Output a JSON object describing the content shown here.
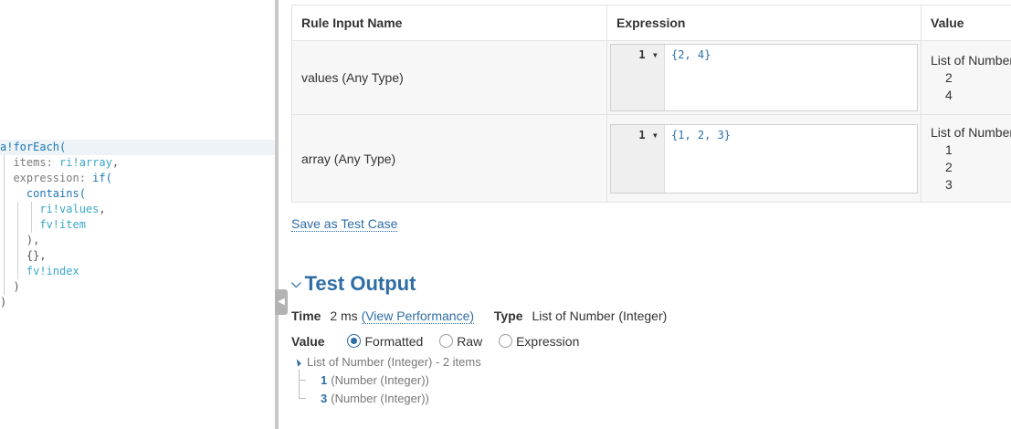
{
  "code_editor": {
    "lines": [
      {
        "parts": [
          {
            "t": "a!forEach(",
            "c": "fn"
          }
        ]
      },
      {
        "parts": [
          {
            "t": "  items: ",
            "c": "key"
          },
          {
            "t": "ri!array",
            "c": "ref"
          },
          {
            "t": ",",
            "c": "p"
          }
        ]
      },
      {
        "parts": [
          {
            "t": "  expression: ",
            "c": "key"
          },
          {
            "t": "if(",
            "c": "fn"
          }
        ]
      },
      {
        "parts": [
          {
            "t": "    contains(",
            "c": "fn"
          }
        ]
      },
      {
        "parts": [
          {
            "t": "      ri!values",
            "c": "ref"
          },
          {
            "t": ",",
            "c": "p"
          }
        ]
      },
      {
        "parts": [
          {
            "t": "      fv!item",
            "c": "ref"
          }
        ]
      },
      {
        "parts": [
          {
            "t": "    ),",
            "c": "p"
          }
        ]
      },
      {
        "parts": [
          {
            "t": "    {},",
            "c": "p"
          }
        ]
      },
      {
        "parts": [
          {
            "t": "    fv!index",
            "c": "ref"
          }
        ]
      },
      {
        "parts": [
          {
            "t": "  )",
            "c": "p"
          }
        ]
      },
      {
        "parts": [
          {
            "t": ")",
            "c": "p"
          }
        ]
      }
    ]
  },
  "rule_inputs": {
    "headers": [
      "Rule Input Name",
      "Expression",
      "Value"
    ],
    "rows": [
      {
        "name": "values (Any Type)",
        "line_no": "1",
        "expression": "{2, 4}",
        "value_type": "List of Number",
        "value_items": [
          "2",
          "4"
        ]
      },
      {
        "name": "array (Any Type)",
        "line_no": "1",
        "expression": "{1, 2, 3}",
        "value_type": "List of Number",
        "value_items": [
          "1",
          "2",
          "3"
        ]
      }
    ]
  },
  "save_test_case": "Save as Test Case",
  "test_output": {
    "title": "Test Output",
    "time_label": "Time",
    "time_value": "2 ms",
    "view_performance": "(View Performance)",
    "type_label": "Type",
    "type_value": "List of Number (Integer)",
    "value_label": "Value",
    "format_options": [
      {
        "label": "Formatted",
        "selected": true
      },
      {
        "label": "Raw",
        "selected": false
      },
      {
        "label": "Expression",
        "selected": false
      }
    ],
    "tree_root": "List of Number (Integer) - 2 items",
    "tree_items": [
      {
        "value": "1",
        "type": "(Number (Integer))"
      },
      {
        "value": "3",
        "type": "(Number (Integer))"
      }
    ]
  },
  "colors": {
    "accent": "#2e6da4",
    "code_function": "#1f78b4",
    "code_reference": "#3aa7c9"
  },
  "icons": {
    "collapse_tab": "chevron-left-icon",
    "section_toggle": "chevron-down-icon",
    "tree_toggle": "triangle-expanded-icon"
  }
}
